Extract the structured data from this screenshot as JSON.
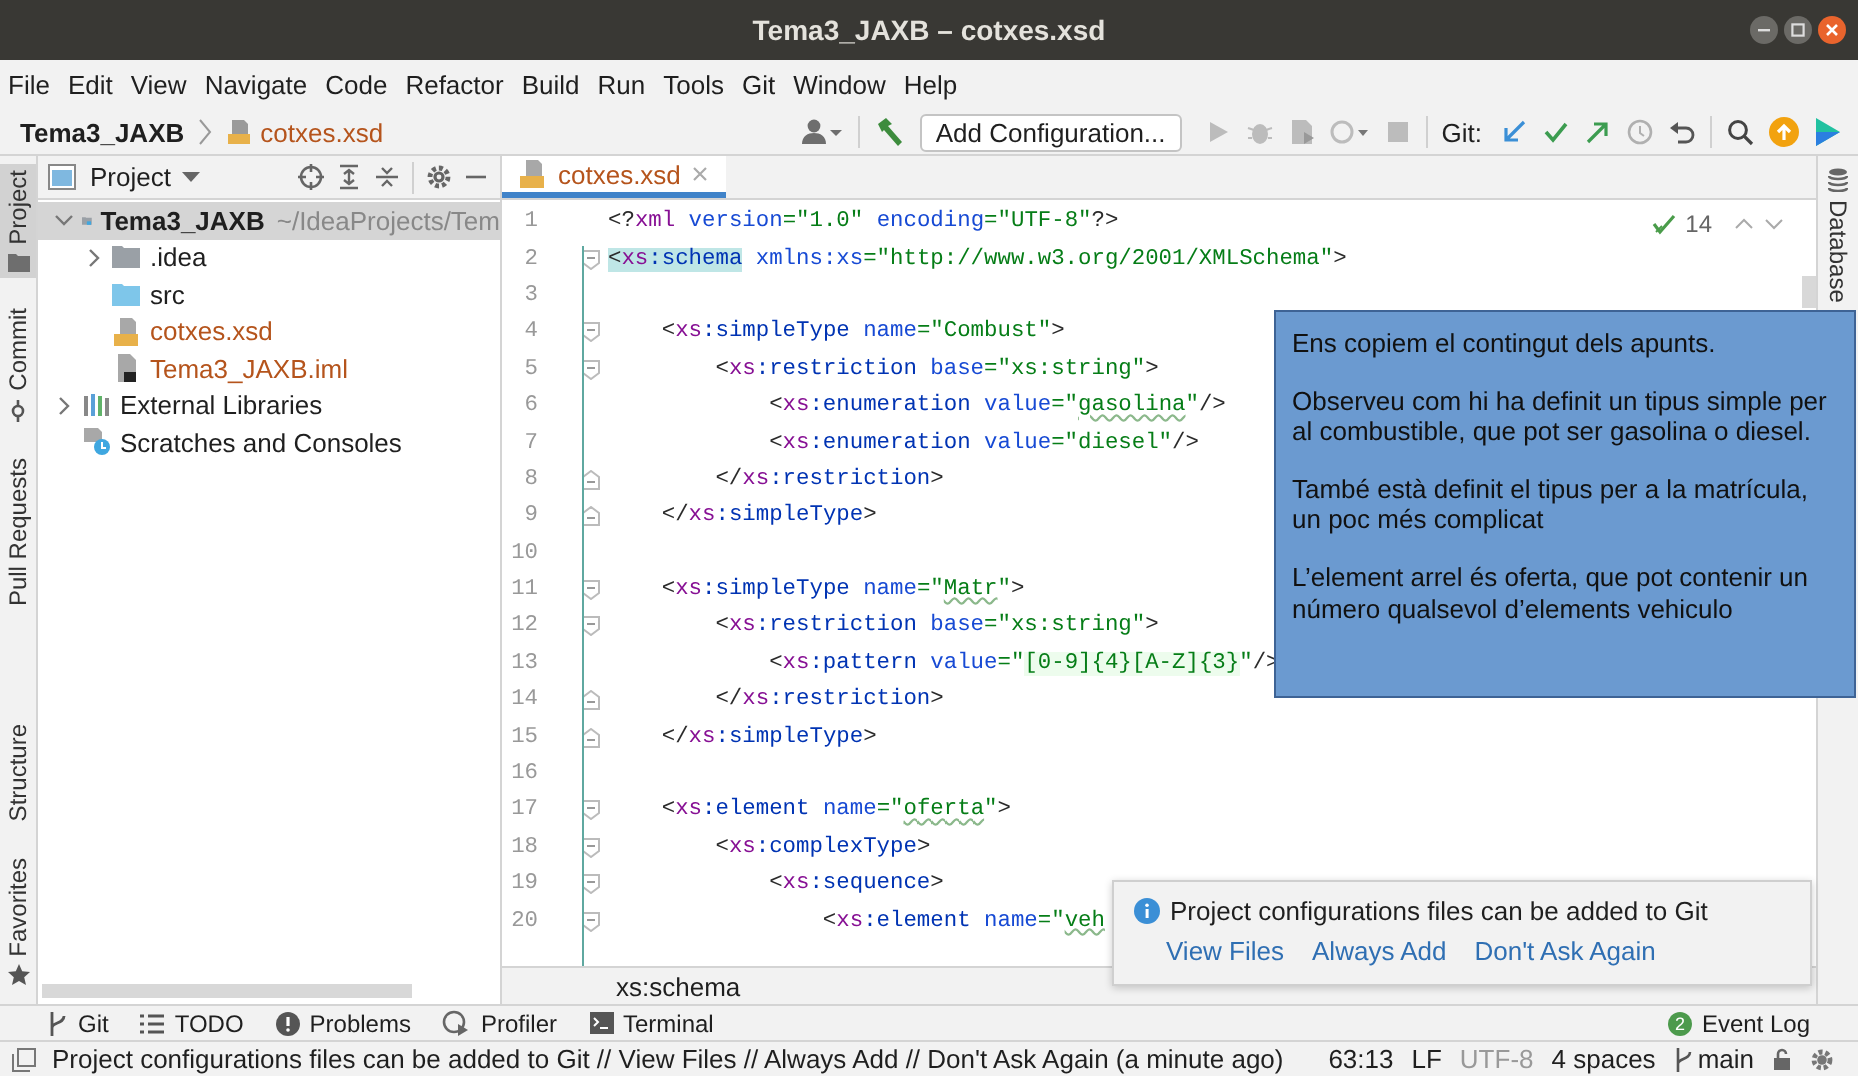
{
  "window": {
    "title": "Tema3_JAXB – cotxes.xsd"
  },
  "menu": [
    "File",
    "Edit",
    "View",
    "Navigate",
    "Code",
    "Refactor",
    "Build",
    "Run",
    "Tools",
    "Git",
    "Window",
    "Help"
  ],
  "navbar": {
    "project": "Tema3_JAXB",
    "file": "cotxes.xsd",
    "run_config": "Add Configuration...",
    "git_label": "Git:"
  },
  "left_tabs": [
    {
      "label": "Project",
      "kind": "project",
      "selected": true
    },
    {
      "label": "Commit",
      "kind": "commit",
      "selected": false
    },
    {
      "label": "Pull Requests",
      "kind": "pull",
      "selected": false
    },
    {
      "label": "Structure",
      "kind": "structure",
      "selected": false
    },
    {
      "label": "Favorites",
      "kind": "favorites",
      "selected": false
    }
  ],
  "project_panel": {
    "title": "Project",
    "tree": [
      {
        "label": "Tema3_JAXB",
        "path": "~/IdeaProjects/Tem",
        "kind": "module",
        "expanded": true,
        "selected": true,
        "color": "#1f1f1f",
        "children": [
          {
            "label": ".idea",
            "kind": "folder",
            "expanded": false,
            "selected": false,
            "color": "#1f1f1f"
          },
          {
            "label": "src",
            "kind": "source",
            "selected": false,
            "color": "#1f1f1f"
          },
          {
            "label": "cotxes.xsd",
            "kind": "xsd",
            "selected": false,
            "color": "#b5541c"
          },
          {
            "label": "Tema3_JAXB.iml",
            "kind": "iml",
            "selected": false,
            "color": "#b5541c"
          }
        ]
      },
      {
        "label": "External Libraries",
        "kind": "libraries",
        "expanded": false,
        "selected": false,
        "color": "#1f1f1f"
      },
      {
        "label": "Scratches and Consoles",
        "kind": "scratches",
        "selected": false,
        "color": "#1f1f1f"
      }
    ]
  },
  "editor": {
    "tab": {
      "label": "cotxes.xsd",
      "selected": true
    },
    "inspections": "14",
    "breadcrumb": "xs:schema",
    "lines": [
      {
        "number": "1",
        "kind": "plain",
        "tokens": [
          {
            "kind": "p",
            "text": "<?"
          },
          {
            "kind": "ns",
            "text": "xml"
          },
          {
            "kind": "attr",
            "text": " version"
          },
          {
            "kind": "str",
            "text": "=\"1.0\""
          },
          {
            "kind": "attr",
            "text": " encoding"
          },
          {
            "kind": "str",
            "text": "=\"UTF-8\""
          },
          {
            "kind": "p",
            "text": "?>"
          }
        ]
      },
      {
        "number": "2",
        "kind": "open",
        "tokens": [
          {
            "kind": "ph",
            "text": "<"
          },
          {
            "kind": "nsh",
            "text": "xs"
          },
          {
            "kind": "tagh",
            "text": ":schema"
          },
          {
            "kind": "attr",
            "text": " xmlns:xs"
          },
          {
            "kind": "str",
            "text": "=\"http://www.w3.org/2001/XMLSchema\""
          },
          {
            "kind": "p",
            "text": ">"
          }
        ]
      },
      {
        "number": "3",
        "kind": "plain"
      },
      {
        "number": "4",
        "kind": "open",
        "tokens": [
          {
            "kind": "p",
            "text": "    <"
          },
          {
            "kind": "ns",
            "text": "xs"
          },
          {
            "kind": "tag",
            "text": ":simpleType"
          },
          {
            "kind": "attr",
            "text": " name"
          },
          {
            "kind": "str",
            "text": "=\"Combust\""
          },
          {
            "kind": "p",
            "text": ">"
          }
        ]
      },
      {
        "number": "5",
        "kind": "open",
        "tokens": [
          {
            "kind": "p",
            "text": "        <"
          },
          {
            "kind": "ns",
            "text": "xs"
          },
          {
            "kind": "tag",
            "text": ":restriction"
          },
          {
            "kind": "attr",
            "text": " base"
          },
          {
            "kind": "str",
            "text": "=\"xs:string\""
          },
          {
            "kind": "p",
            "text": ">"
          }
        ]
      },
      {
        "number": "6",
        "kind": "plain",
        "tokens": [
          {
            "kind": "p",
            "text": "            <"
          },
          {
            "kind": "ns",
            "text": "xs"
          },
          {
            "kind": "tag",
            "text": ":enumeration"
          },
          {
            "kind": "attr",
            "text": " value"
          },
          {
            "kind": "str",
            "text": "=\""
          },
          {
            "kind": "typo",
            "text": "gasolina"
          },
          {
            "kind": "str",
            "text": "\""
          },
          {
            "kind": "p",
            "text": "/>"
          }
        ]
      },
      {
        "number": "7",
        "kind": "plain",
        "tokens": [
          {
            "kind": "p",
            "text": "            <"
          },
          {
            "kind": "ns",
            "text": "xs"
          },
          {
            "kind": "tag",
            "text": ":enumeration"
          },
          {
            "kind": "attr",
            "text": " value"
          },
          {
            "kind": "str",
            "text": "=\"diesel\""
          },
          {
            "kind": "p",
            "text": "/>"
          }
        ]
      },
      {
        "number": "8",
        "kind": "close",
        "tokens": [
          {
            "kind": "p",
            "text": "        </"
          },
          {
            "kind": "ns",
            "text": "xs"
          },
          {
            "kind": "tag",
            "text": ":restriction"
          },
          {
            "kind": "p",
            "text": ">"
          }
        ]
      },
      {
        "number": "9",
        "kind": "close",
        "tokens": [
          {
            "kind": "p",
            "text": "    </"
          },
          {
            "kind": "ns",
            "text": "xs"
          },
          {
            "kind": "tag",
            "text": ":simpleType"
          },
          {
            "kind": "p",
            "text": ">"
          }
        ]
      },
      {
        "number": "10",
        "kind": "plain"
      },
      {
        "number": "11",
        "kind": "open",
        "tokens": [
          {
            "kind": "p",
            "text": "    <"
          },
          {
            "kind": "ns",
            "text": "xs"
          },
          {
            "kind": "tag",
            "text": ":simpleType"
          },
          {
            "kind": "attr",
            "text": " name"
          },
          {
            "kind": "str",
            "text": "=\""
          },
          {
            "kind": "typo",
            "text": "Matr"
          },
          {
            "kind": "str",
            "text": "\""
          },
          {
            "kind": "p",
            "text": ">"
          }
        ]
      },
      {
        "number": "12",
        "kind": "open",
        "tokens": [
          {
            "kind": "p",
            "text": "        <"
          },
          {
            "kind": "ns",
            "text": "xs"
          },
          {
            "kind": "tag",
            "text": ":restriction"
          },
          {
            "kind": "attr",
            "text": " base"
          },
          {
            "kind": "str",
            "text": "=\"xs:string\""
          },
          {
            "kind": "p",
            "text": ">"
          }
        ]
      },
      {
        "number": "13",
        "kind": "plain",
        "tokens": [
          {
            "kind": "p",
            "text": "            <"
          },
          {
            "kind": "ns",
            "text": "xs"
          },
          {
            "kind": "tag",
            "text": ":pattern"
          },
          {
            "kind": "attr",
            "text": " value"
          },
          {
            "kind": "str",
            "text": "=\""
          },
          {
            "kind": "re",
            "text": "[0-9]{4}[A-Z]{3}"
          },
          {
            "kind": "str",
            "text": "\""
          },
          {
            "kind": "p",
            "text": "/>"
          }
        ]
      },
      {
        "number": "14",
        "kind": "close",
        "tokens": [
          {
            "kind": "p",
            "text": "        </"
          },
          {
            "kind": "ns",
            "text": "xs"
          },
          {
            "kind": "tag",
            "text": ":restriction"
          },
          {
            "kind": "p",
            "text": ">"
          }
        ]
      },
      {
        "number": "15",
        "kind": "close",
        "tokens": [
          {
            "kind": "p",
            "text": "    </"
          },
          {
            "kind": "ns",
            "text": "xs"
          },
          {
            "kind": "tag",
            "text": ":simpleType"
          },
          {
            "kind": "p",
            "text": ">"
          }
        ]
      },
      {
        "number": "16",
        "kind": "plain"
      },
      {
        "number": "17",
        "kind": "open",
        "tokens": [
          {
            "kind": "p",
            "text": "    <"
          },
          {
            "kind": "ns",
            "text": "xs"
          },
          {
            "kind": "tag",
            "text": ":element"
          },
          {
            "kind": "attr",
            "text": " name"
          },
          {
            "kind": "str",
            "text": "=\""
          },
          {
            "kind": "typo",
            "text": "oferta"
          },
          {
            "kind": "str",
            "text": "\""
          },
          {
            "kind": "p",
            "text": ">"
          }
        ]
      },
      {
        "number": "18",
        "kind": "open",
        "tokens": [
          {
            "kind": "p",
            "text": "        <"
          },
          {
            "kind": "ns",
            "text": "xs"
          },
          {
            "kind": "tag",
            "text": ":complexType"
          },
          {
            "kind": "p",
            "text": ">"
          }
        ]
      },
      {
        "number": "19",
        "kind": "open",
        "tokens": [
          {
            "kind": "p",
            "text": "            <"
          },
          {
            "kind": "ns",
            "text": "xs"
          },
          {
            "kind": "tag",
            "text": ":sequence"
          },
          {
            "kind": "p",
            "text": ">"
          }
        ]
      },
      {
        "number": "20",
        "kind": "open",
        "tokens": [
          {
            "kind": "p",
            "text": "                <"
          },
          {
            "kind": "ns",
            "text": "xs"
          },
          {
            "kind": "tag",
            "text": ":element"
          },
          {
            "kind": "attr",
            "text": " name"
          },
          {
            "kind": "str",
            "text": "=\""
          },
          {
            "kind": "typo",
            "text": "veh"
          }
        ]
      }
    ]
  },
  "note": {
    "paragraphs": [
      "Ens copiem el contingut dels apunts.",
      "Observeu com hi ha definit un tipus simple per al combustible, que pot ser gasolina o diesel.",
      "També està definit el tipus per a la matrícula, un poc més complicat",
      "L’element arrel és oferta, que pot contenir un número qualsevol d’elements vehiculo"
    ]
  },
  "notification": {
    "message": "Project configurations files can be added to Git",
    "actions": [
      "View Files",
      "Always Add",
      "Don't Ask Again"
    ]
  },
  "right_tabs": [
    {
      "label": "Database",
      "selected": false
    }
  ],
  "tool_windows": [
    {
      "label": "Git",
      "kind": "git"
    },
    {
      "label": "TODO",
      "kind": "todo"
    },
    {
      "label": "Problems",
      "kind": "problems"
    },
    {
      "label": "Profiler",
      "kind": "profiler"
    },
    {
      "label": "Terminal",
      "kind": "terminal"
    }
  ],
  "event_log": {
    "label": "Event Log",
    "count": "2"
  },
  "status_bar": {
    "message": "Project configurations files can be added to Git // View Files // Always Add // Don't Ask Again (a minute ago)",
    "position": "63:13",
    "line_separator": "LF",
    "encoding": "UTF-8",
    "indent": "4 spaces",
    "branch": "main"
  }
}
